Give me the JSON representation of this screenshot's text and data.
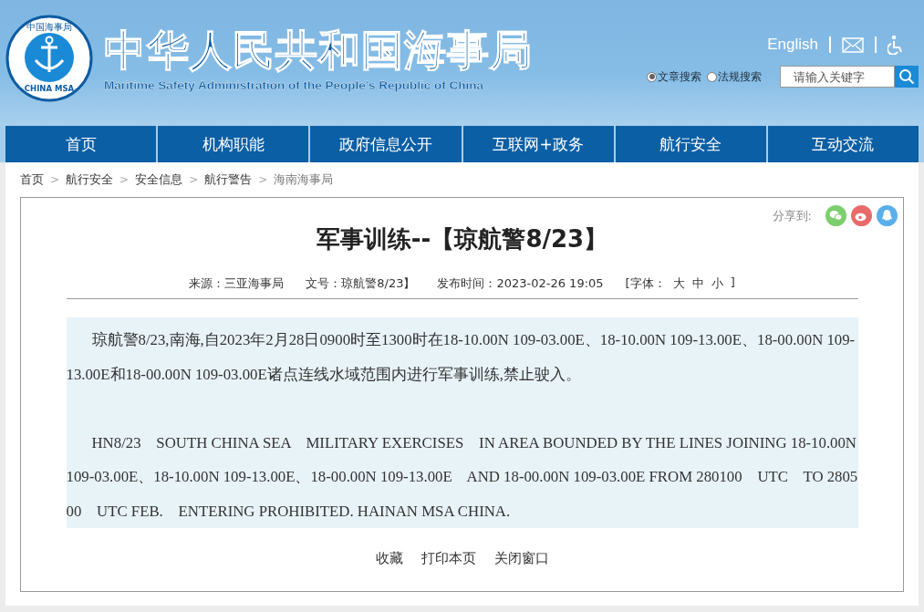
{
  "header": {
    "title": "中华人民共和国海事局",
    "subtitle": "Maritime Safety Administration of the People’s Republic of China",
    "logo_text": "CHINA MSA",
    "logo_top": "中国海事局",
    "language_link": "English",
    "search_options": [
      {
        "label": "文章搜索",
        "selected": true
      },
      {
        "label": "法规搜索",
        "selected": false
      }
    ],
    "search_placeholder": "请输入关键字"
  },
  "nav": [
    {
      "label": "首页"
    },
    {
      "label": "机构职能"
    },
    {
      "label": "政府信息公开"
    },
    {
      "label": "互联网+政务"
    },
    {
      "label": "航行安全"
    },
    {
      "label": "互动交流"
    }
  ],
  "breadcrumb_separator": ">",
  "breadcrumb": [
    {
      "label": "首页",
      "current": false
    },
    {
      "label": "航行安全",
      "current": false
    },
    {
      "label": "安全信息",
      "current": false
    },
    {
      "label": "航行警告",
      "current": false
    },
    {
      "label": "海南海事局",
      "current": true
    }
  ],
  "article": {
    "share_label": "分享到:",
    "title": "军事训练--【琼航警8/23】",
    "meta": [
      "来源：三亚海事局",
      "文号：琼航警8/23】",
      "发布时间：2023-02-26 19:05"
    ],
    "font_label_open": "[字体：",
    "font_sizes": [
      "大",
      "中",
      "小"
    ],
    "font_label_close": "]",
    "paragraphs": [
      "琼航警8/23,南海,自2023年2月28日0900时至1300时在18-10.00N 109-03.00E、18-10.00N 109-13.00E、18-00.00N 109-13.00E和18-00.00N 109-03.00E诸点连线水域范围内进行军事训练,禁止驶入。",
      "HN8/23    SOUTH CHINA SEA    MILITARY EXERCISES    IN AREA BOUNDED BY THE LINES JOINING 18-10.00N 109-03.00E、18-10.00N 109-13.00E、18-00.00N 109-13.00E    AND 18-00.00N 109-03.00E FROM 280100    UTC    TO 280500    UTC FEB.    ENTERING PROHIBITED. HAINAN MSA CHINA."
    ],
    "actions": [
      "收藏",
      "打印本页",
      "关闭窗口"
    ]
  }
}
